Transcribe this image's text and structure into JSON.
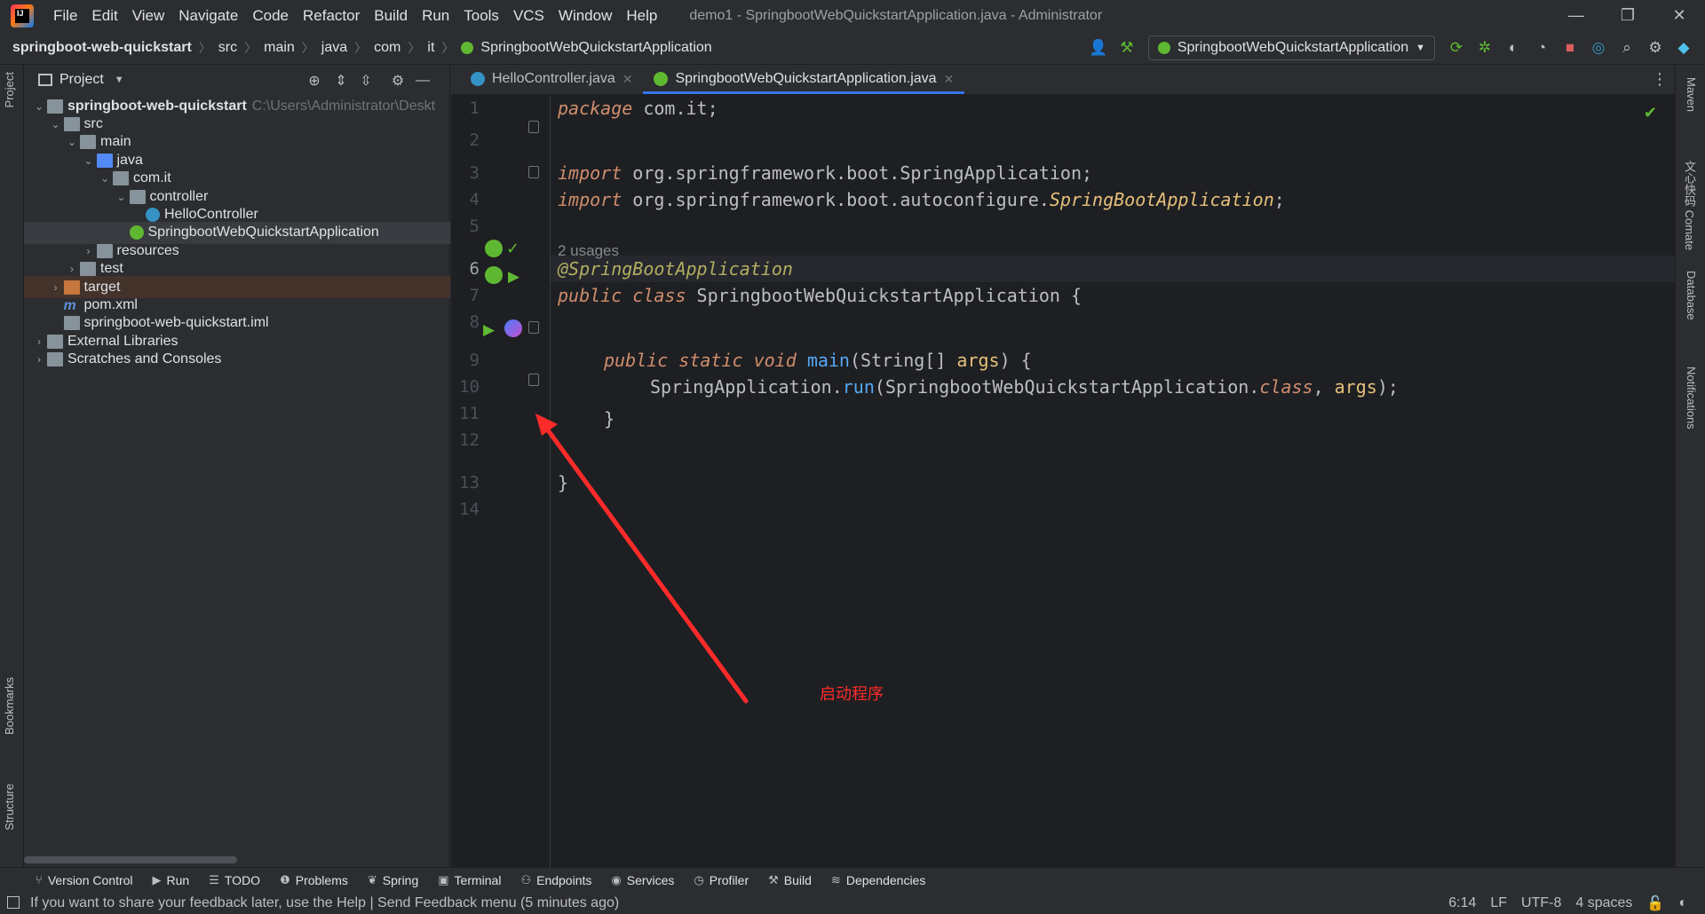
{
  "titlebar": {
    "menu": [
      "File",
      "Edit",
      "View",
      "Navigate",
      "Code",
      "Refactor",
      "Build",
      "Run",
      "Tools",
      "VCS",
      "Window",
      "Help"
    ],
    "window_title": "demo1 - SpringbootWebQuickstartApplication.java - Administrator"
  },
  "navbar": {
    "crumbs": [
      "springboot-web-quickstart",
      "src",
      "main",
      "java",
      "com",
      "it",
      "SpringbootWebQuickstartApplication"
    ],
    "run_config": "SpringbootWebQuickstartApplication"
  },
  "left_stripe": {
    "project": "Project",
    "bookmarks": "Bookmarks",
    "structure": "Structure"
  },
  "project_panel": {
    "title": "Project",
    "tree": [
      {
        "label": "springboot-web-quickstart",
        "hint": "C:\\Users\\Administrator\\Deskt",
        "depth": 0,
        "expanded": true,
        "icon": "module-folder-icon"
      },
      {
        "label": "src",
        "depth": 1,
        "expanded": true,
        "icon": "folder-icon"
      },
      {
        "label": "main",
        "depth": 2,
        "expanded": true,
        "icon": "folder-icon"
      },
      {
        "label": "java",
        "depth": 3,
        "expanded": true,
        "icon": "source-folder-icon"
      },
      {
        "label": "com.it",
        "depth": 4,
        "expanded": true,
        "icon": "package-icon"
      },
      {
        "label": "controller",
        "depth": 5,
        "expanded": true,
        "icon": "package-icon"
      },
      {
        "label": "HelloController",
        "depth": 6,
        "icon": "class-icon"
      },
      {
        "label": "SpringbootWebQuickstartApplication",
        "depth": 5,
        "icon": "spring-class-icon",
        "selected": true
      },
      {
        "label": "resources",
        "depth": 3,
        "expanded": false,
        "icon": "resources-folder-icon"
      },
      {
        "label": "test",
        "depth": 2,
        "expanded": false,
        "icon": "folder-icon"
      },
      {
        "label": "target",
        "depth": 1,
        "expanded": false,
        "icon": "excluded-folder-icon"
      },
      {
        "label": "pom.xml",
        "depth": 1,
        "icon": "maven-icon"
      },
      {
        "label": "springboot-web-quickstart.iml",
        "depth": 1,
        "icon": "iml-file-icon"
      },
      {
        "label": "External Libraries",
        "depth": 0,
        "expanded": false,
        "icon": "library-icon"
      },
      {
        "label": "Scratches and Consoles",
        "depth": 0,
        "expanded": false,
        "icon": "scratches-icon"
      }
    ]
  },
  "editor": {
    "tabs": [
      {
        "label": "HelloController.java",
        "active": false
      },
      {
        "label": "SpringbootWebQuickstartApplication.java",
        "active": true
      }
    ],
    "line_numbers": [
      "1",
      "2",
      "3",
      "4",
      "5",
      "6",
      "7",
      "8",
      "9",
      "10",
      "11",
      "12",
      "13",
      "14"
    ],
    "usages": "2 usages",
    "code": {
      "l1_kw": "package",
      "l1_rest": " com.it;",
      "l3_kw": "import",
      "l3_rest": " org.springframework.boot.SpringApplication;",
      "l4_kw": "import",
      "l4_pre": " org.springframework.boot.autoconfigure.",
      "l4_cls": "SpringBootApplication",
      "l4_end": ";",
      "l6_ann": "@SpringBootApplication",
      "l7_kw1": "public",
      "l7_kw2": "class",
      "l7_rest": " SpringbootWebQuickstartApplication {",
      "l9_kw1": "public",
      "l9_kw2": "static",
      "l9_kw3": "void",
      "l9_fn": "main",
      "l9_a": "(String[] ",
      "l9_p": "args",
      "l9_b": ") {",
      "l10_a": "SpringApplication.",
      "l10_fn": "run",
      "l10_b": "(SpringbootWebQuickstartApplication.",
      "l10_kw": "class",
      "l10_c": ", ",
      "l10_p": "args",
      "l10_d": ");",
      "l11": "}",
      "l13": "}"
    }
  },
  "right_stripe": {
    "maven": "Maven",
    "comate": "文心快码 Comate",
    "database": "Database",
    "notifications": "Notifications"
  },
  "bottom_tools": [
    "Version Control",
    "Run",
    "TODO",
    "Problems",
    "Spring",
    "Terminal",
    "Endpoints",
    "Services",
    "Profiler",
    "Build",
    "Dependencies"
  ],
  "status": {
    "message": "If you want to share your feedback later, use the Help | Send Feedback menu (5 minutes ago)",
    "position": "6:14",
    "line_sep": "LF",
    "encoding": "UTF-8",
    "indent": "4 spaces"
  },
  "annotation": {
    "text": "启动程序",
    "color": "#ff2a2a"
  }
}
